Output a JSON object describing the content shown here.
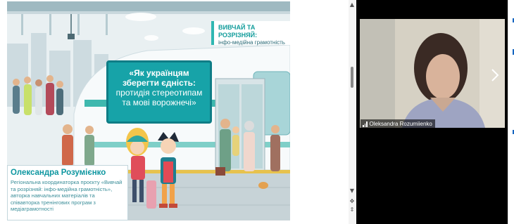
{
  "slide": {
    "badge_line1": "ВИВЧАЙ ТА РОЗРІЗНЯЙ:",
    "badge_line2": "інфо-медійна грамотність",
    "title_line1": "«Як українцям",
    "title_line2": "зберегти єдність:",
    "title_line3": "протидія стереотипам",
    "title_line4": "та мові ворожнечі»",
    "speaker_name": "Олександра Розумієнко",
    "speaker_role": "Регіональна координаторка проєкту «Вивчай та розрізняй: інфо-медійна грамотність», авторка навчальних матеріалів та співавторка тренінгових програм з медіаграмотності"
  },
  "participant": {
    "name": "Oleksandra Rozumiienko"
  },
  "colors": {
    "teal": "#17a3a8",
    "teal_dark": "#0f7d86",
    "video_bg": "#000000"
  }
}
